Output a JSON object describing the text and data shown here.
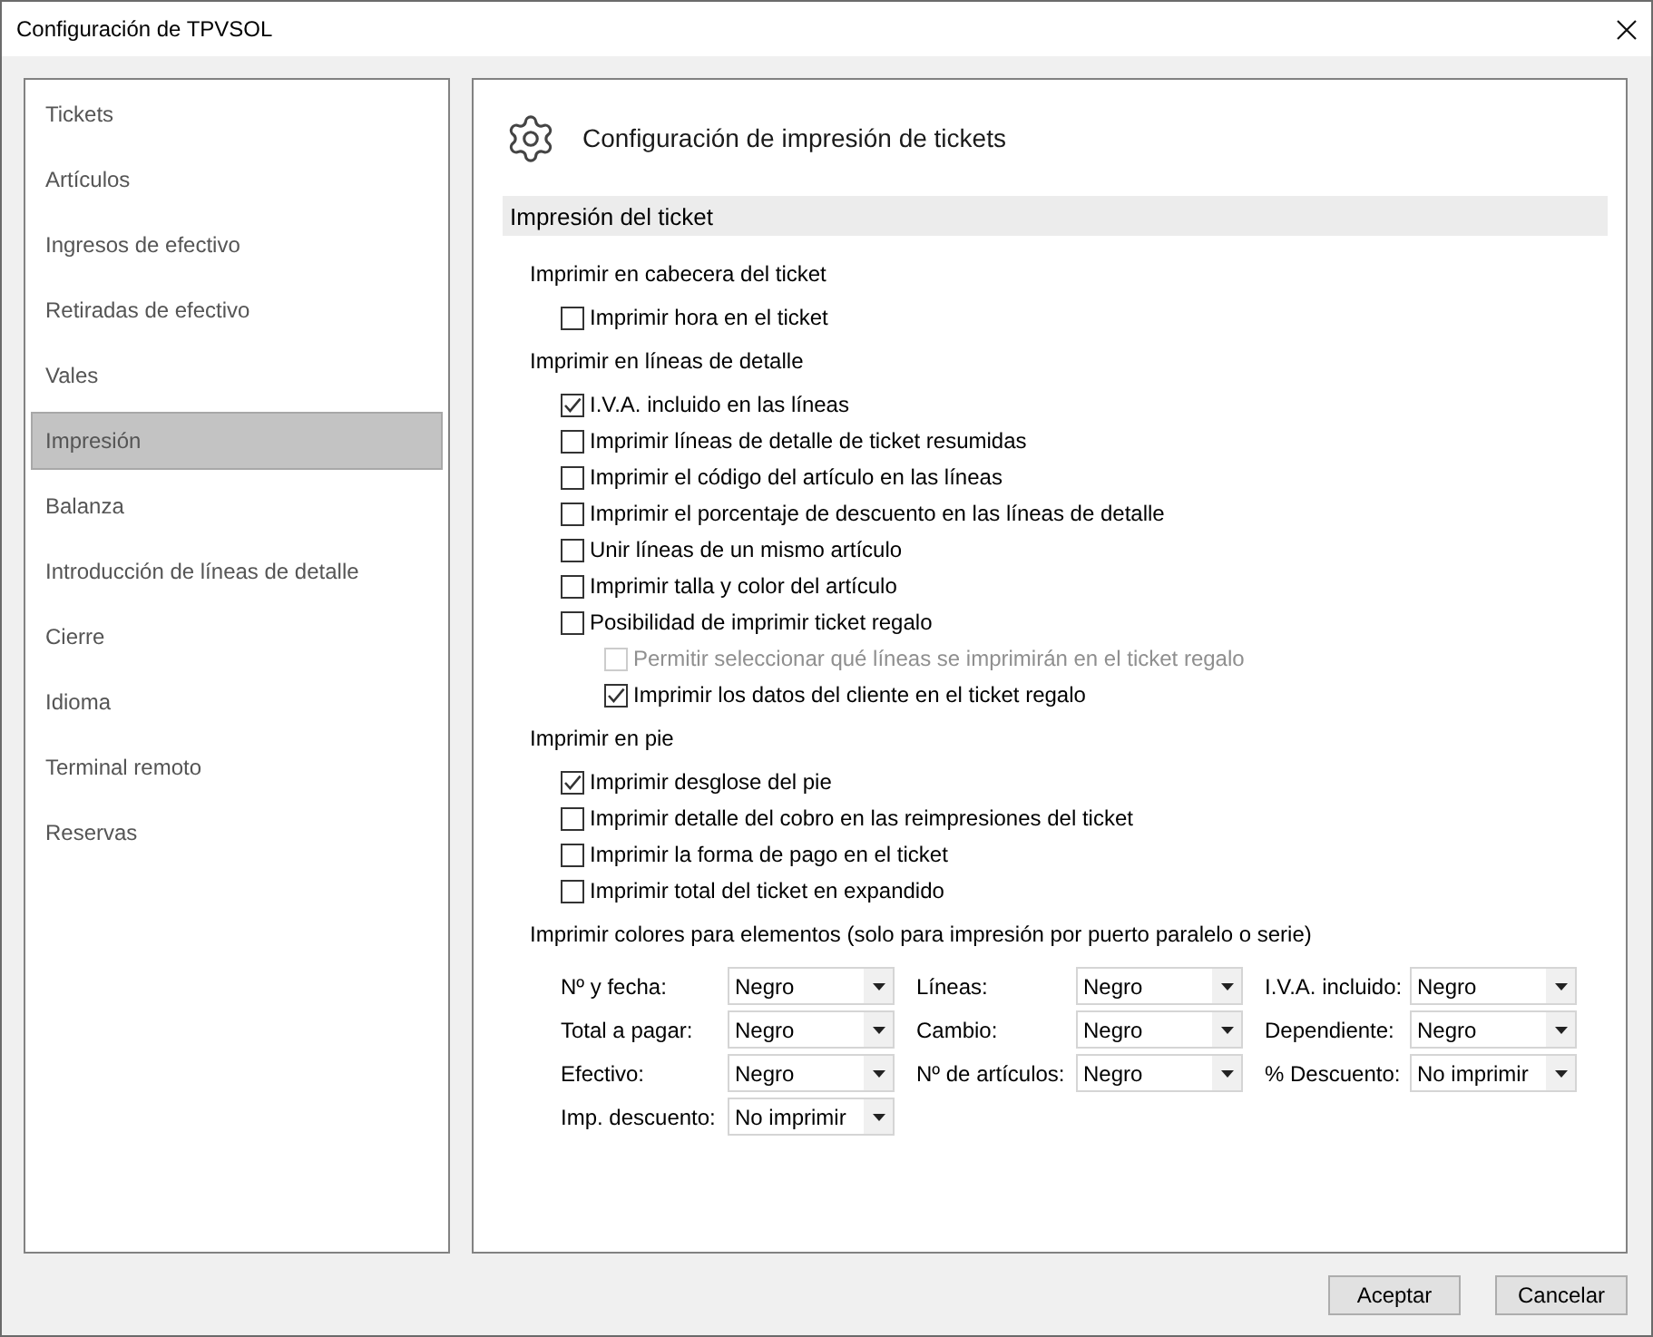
{
  "window": {
    "title": "Configuración de TPVSOL"
  },
  "sidebar": {
    "items": [
      {
        "label": "Tickets",
        "selected": false
      },
      {
        "label": "Artículos",
        "selected": false
      },
      {
        "label": "Ingresos de efectivo",
        "selected": false
      },
      {
        "label": "Retiradas de efectivo",
        "selected": false
      },
      {
        "label": "Vales",
        "selected": false
      },
      {
        "label": "Impresión",
        "selected": true
      },
      {
        "label": "Balanza",
        "selected": false
      },
      {
        "label": "Introducción de líneas de detalle",
        "selected": false
      },
      {
        "label": "Cierre",
        "selected": false
      },
      {
        "label": "Idioma",
        "selected": false
      },
      {
        "label": "Terminal remoto",
        "selected": false
      },
      {
        "label": "Reservas",
        "selected": false
      }
    ]
  },
  "panel": {
    "title": "Configuración de impresión de tickets",
    "section": "Impresión del ticket",
    "groups": [
      {
        "label": "Imprimir en cabecera del ticket",
        "options": [
          {
            "label": "Imprimir hora en el ticket",
            "checked": false,
            "disabled": false
          }
        ]
      },
      {
        "label": "Imprimir en líneas de detalle",
        "options": [
          {
            "label": "I.V.A. incluido en las líneas",
            "checked": true,
            "disabled": false
          },
          {
            "label": "Imprimir líneas de detalle de ticket resumidas",
            "checked": false,
            "disabled": false
          },
          {
            "label": "Imprimir el código del artículo en las líneas",
            "checked": false,
            "disabled": false
          },
          {
            "label": "Imprimir el porcentaje de descuento en las líneas de detalle",
            "checked": false,
            "disabled": false
          },
          {
            "label": "Unir líneas de un mismo artículo",
            "checked": false,
            "disabled": false
          },
          {
            "label": "Imprimir talla y color del artículo",
            "checked": false,
            "disabled": false
          },
          {
            "label": "Posibilidad de imprimir ticket regalo",
            "checked": false,
            "disabled": false,
            "children": [
              {
                "label": "Permitir seleccionar qué líneas se imprimirán en el ticket regalo",
                "checked": false,
                "disabled": true
              },
              {
                "label": "Imprimir los datos del cliente en el ticket regalo",
                "checked": true,
                "disabled": false
              }
            ]
          }
        ]
      },
      {
        "label": "Imprimir en pie",
        "options": [
          {
            "label": "Imprimir desglose del pie",
            "checked": true,
            "disabled": false
          },
          {
            "label": "Imprimir detalle del cobro en las reimpresiones del ticket",
            "checked": false,
            "disabled": false
          },
          {
            "label": "Imprimir la forma de pago en el ticket",
            "checked": false,
            "disabled": false
          },
          {
            "label": "Imprimir total del ticket en expandido",
            "checked": false,
            "disabled": false
          }
        ]
      }
    ],
    "colors": {
      "label": "Imprimir colores para elementos (solo para impresión por puerto paralelo o serie)",
      "fields": [
        {
          "label": "Nº y fecha:",
          "value": "Negro"
        },
        {
          "label": "Líneas:",
          "value": "Negro"
        },
        {
          "label": "I.V.A. incluido:",
          "value": "Negro"
        },
        {
          "label": "Total a pagar:",
          "value": "Negro"
        },
        {
          "label": "Cambio:",
          "value": "Negro"
        },
        {
          "label": "Dependiente:",
          "value": "Negro"
        },
        {
          "label": "Efectivo:",
          "value": "Negro"
        },
        {
          "label": "Nº de artículos:",
          "value": "Negro"
        },
        {
          "label": "% Descuento:",
          "value": "No imprimir"
        },
        {
          "label": "Imp. descuento:",
          "value": "No imprimir"
        }
      ]
    }
  },
  "buttons": [
    "Aceptar",
    "Cancelar"
  ]
}
